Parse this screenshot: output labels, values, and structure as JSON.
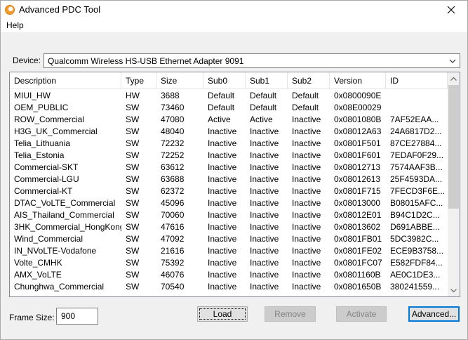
{
  "window": {
    "title": "Advanced PDC Tool"
  },
  "menu": {
    "help": "Help"
  },
  "device": {
    "label": "Device:",
    "selected": "Qualcomm Wireless HS-USB Ethernet Adapter 9091"
  },
  "table": {
    "columns": [
      "Description",
      "Type",
      "Size",
      "Sub0",
      "Sub1",
      "Sub2",
      "Version",
      "ID"
    ],
    "rows": [
      [
        "MIUI_HW",
        "HW",
        "3688",
        "Default",
        "Default",
        "Default",
        "0x0800090E",
        ""
      ],
      [
        "OEM_PUBLIC",
        "SW",
        "73460",
        "Default",
        "Default",
        "Default",
        "0x08E00029",
        ""
      ],
      [
        "ROW_Commercial",
        "SW",
        "47080",
        "Active",
        "Active",
        "Inactive",
        "0x0801080B",
        "7AF52EAA..."
      ],
      [
        "H3G_UK_Commercial",
        "SW",
        "48040",
        "Inactive",
        "Inactive",
        "Inactive",
        "0x08012A63",
        "24A6817D2..."
      ],
      [
        "Telia_Lithuania",
        "SW",
        "72232",
        "Inactive",
        "Inactive",
        "Inactive",
        "0x0801F501",
        "87CE27884..."
      ],
      [
        "Telia_Estonia",
        "SW",
        "72252",
        "Inactive",
        "Inactive",
        "Inactive",
        "0x0801F601",
        "7EDAF0F29..."
      ],
      [
        "Commercial-SKT",
        "SW",
        "63612",
        "Inactive",
        "Inactive",
        "Inactive",
        "0x08012713",
        "7574AAF3B..."
      ],
      [
        "Commercial-LGU",
        "SW",
        "63688",
        "Inactive",
        "Inactive",
        "Inactive",
        "0x08012613",
        "25F4593DA..."
      ],
      [
        "Commercial-KT",
        "SW",
        "62372",
        "Inactive",
        "Inactive",
        "Inactive",
        "0x0801F715",
        "7FECD3F6E..."
      ],
      [
        "DTAC_VoLTE_Commercial",
        "SW",
        "45096",
        "Inactive",
        "Inactive",
        "Inactive",
        "0x08013000",
        "B08015AFC..."
      ],
      [
        "AIS_Thailand_Commercial",
        "SW",
        "70060",
        "Inactive",
        "Inactive",
        "Inactive",
        "0x08012E01",
        "B94C1D2C..."
      ],
      [
        "3HK_Commercial_HongKong",
        "SW",
        "47616",
        "Inactive",
        "Inactive",
        "Inactive",
        "0x08013602",
        "D691ABBE..."
      ],
      [
        "Wind_Commercial",
        "SW",
        "47092",
        "Inactive",
        "Inactive",
        "Inactive",
        "0x0801FB01",
        "5DC3982C..."
      ],
      [
        "IN_NVoLTE-Vodafone",
        "SW",
        "21616",
        "Inactive",
        "Inactive",
        "Inactive",
        "0x0801FE02",
        "ECE9B3758..."
      ],
      [
        "Volte_CMHK",
        "SW",
        "75392",
        "Inactive",
        "Inactive",
        "Inactive",
        "0x0801FC07",
        "E582FDF84..."
      ],
      [
        "AMX_VoLTE",
        "SW",
        "46076",
        "Inactive",
        "Inactive",
        "Inactive",
        "0x0801160B",
        "AE0C1DE3..."
      ],
      [
        "Chunghwa_Commercial",
        "SW",
        "70540",
        "Inactive",
        "Inactive",
        "Inactive",
        "0x0801650B",
        "380241559..."
      ]
    ]
  },
  "frame": {
    "label": "Frame Size:",
    "value": "900"
  },
  "buttons": {
    "load": "Load",
    "remove": "Remove",
    "activate": "Activate",
    "advanced": "Advanced..."
  },
  "colors": {
    "accent": "#0078d7",
    "icon": "#f39c2b"
  },
  "icons": {
    "app": "pdc-app-icon",
    "close": "close-icon",
    "dropdown": "chevron-down-icon",
    "scroll_up": "chevron-up-icon",
    "scroll_down": "chevron-down-icon"
  }
}
